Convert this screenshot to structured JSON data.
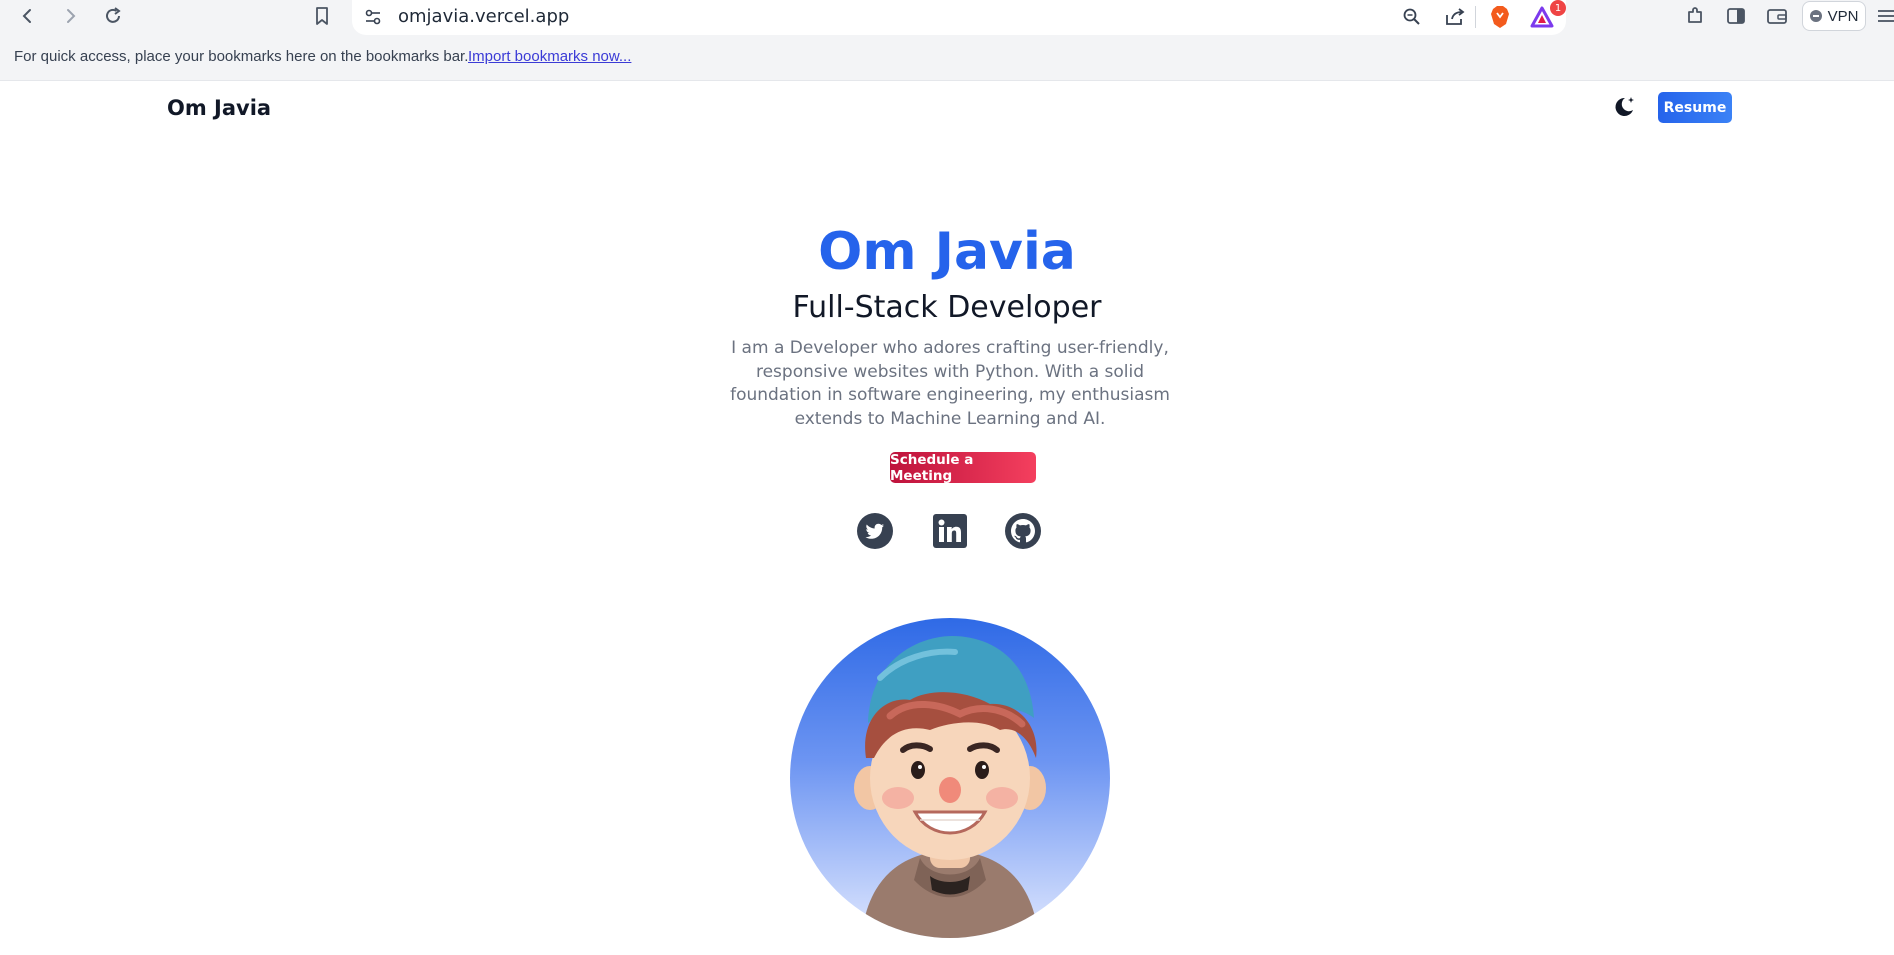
{
  "browser": {
    "url": "omjavia.vercel.app",
    "notification_count": "1",
    "vpn_label": "VPN",
    "bookmarks_bar": {
      "message": "For quick access, place your bookmarks here on the bookmarks bar.",
      "import_link": "Import bookmarks now..."
    },
    "icons": [
      "back-icon",
      "forward-icon",
      "reload-icon",
      "bookmark-icon",
      "site-settings-icon",
      "zoom-icon",
      "share-icon",
      "brave-shield-icon",
      "brave-rewards-icon",
      "extensions-icon",
      "sidebar-icon",
      "wallet-icon"
    ]
  },
  "nav": {
    "brand": "Om Javia",
    "theme_icon": "moon-icon",
    "resume_label": "Resume"
  },
  "hero": {
    "name": "Om Javia",
    "title": "Full-Stack Developer",
    "description": "I am a Developer who adores crafting user-friendly, responsive websites with Python. With a solid foundation in software engineering, my enthusiasm extends to Machine Learning and AI.",
    "cta_label": "Schedule a Meeting",
    "socials": [
      "twitter-icon",
      "linkedin-icon",
      "github-icon"
    ]
  },
  "colors": {
    "accent": "#2563eb",
    "cta": "#e11d48"
  }
}
